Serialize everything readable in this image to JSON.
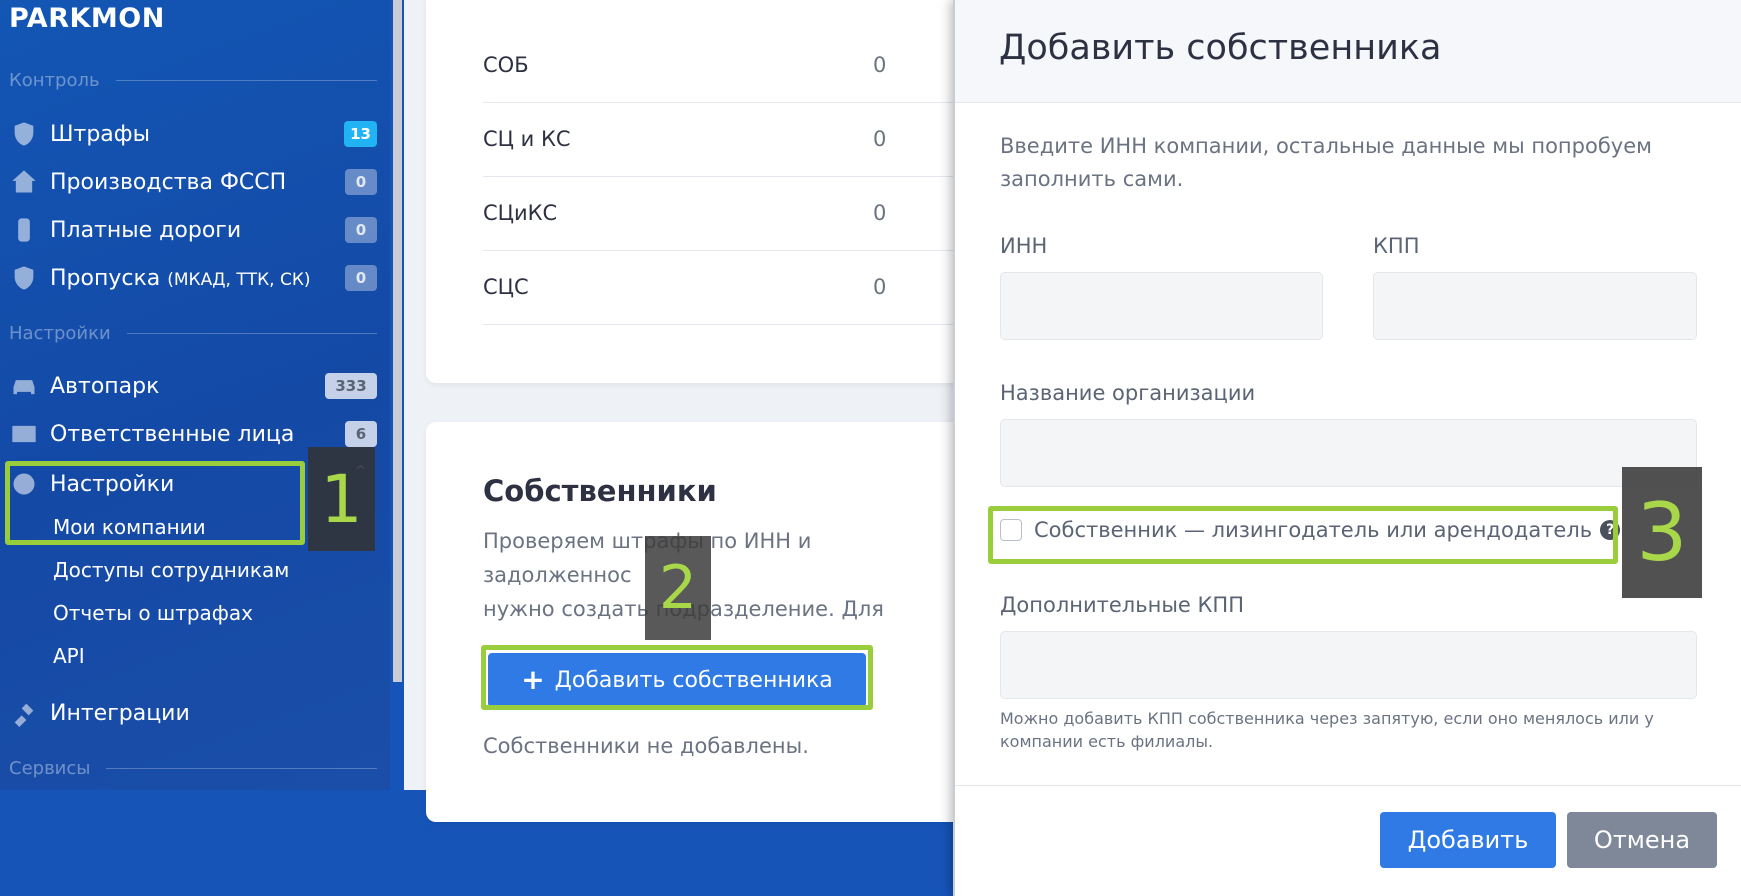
{
  "app": {
    "logo": "PARKMON"
  },
  "sidebar": {
    "sections": [
      {
        "label": "Контроль"
      },
      {
        "label": "Настройки"
      },
      {
        "label": "Сервисы"
      }
    ],
    "items": [
      {
        "label": "Штрафы",
        "badge": "13",
        "icon": "shield-icon"
      },
      {
        "label": "Производства ФССП",
        "badge": "0",
        "icon": "bailiff-icon"
      },
      {
        "label": "Платные дороги",
        "badge": "0",
        "icon": "road-icon"
      },
      {
        "label": "Пропуска",
        "label_small": "(МКАД, ТТК, СК)",
        "badge": "0",
        "icon": "shield-check-icon"
      },
      {
        "label": "Автопарк",
        "badge": "333",
        "icon": "car-icon"
      },
      {
        "label": "Ответственные лица",
        "badge": "6",
        "icon": "id-card-icon"
      },
      {
        "label": "Настройки",
        "icon": "gear-icon",
        "expanded": true
      },
      {
        "label": "Интеграции",
        "icon": "plug-icon"
      }
    ],
    "settings_sub": [
      {
        "label": "Мои компании"
      },
      {
        "label": "Доступы сотрудникам"
      },
      {
        "label": "Отчеты о штрафах"
      },
      {
        "label": "API"
      }
    ]
  },
  "table": {
    "rows": [
      {
        "name": "СОБ",
        "value": "0"
      },
      {
        "name": "СЦ и КС",
        "value": "0"
      },
      {
        "name": "СЦиКС",
        "value": "0"
      },
      {
        "name": "СЦС",
        "value": "0"
      }
    ]
  },
  "owners": {
    "title": "Собственники",
    "description": "Проверяем штрафы по ИНН и задолженнос\nнужно создать подразделение. Для лизинго\nиз раздела Автопарк.",
    "add_button": "Добавить собственника",
    "add_icon": "plus-icon",
    "empty": "Собственники не добавлены."
  },
  "annotations": [
    "1",
    "2",
    "3"
  ],
  "modal": {
    "title": "Добавить собственника",
    "intro": "Введите ИНН компании, остальные данные мы попробуем заполнить сами.",
    "fields": {
      "inn": {
        "label": "ИНН",
        "value": ""
      },
      "kpp": {
        "label": "КПП",
        "value": ""
      },
      "org_name": {
        "label": "Название организации",
        "value": ""
      },
      "extra_kpp": {
        "label": "Дополнительные КПП",
        "value": ""
      }
    },
    "lessor_checkbox": {
      "label": "Собственник — лизингодатель или арендодатель",
      "checked": false,
      "help": "?"
    },
    "extra_kpp_hint": "Можно добавить КПП собственника через запятую, если оно менялось или у компании есть филиалы.",
    "submit": "Добавить",
    "cancel": "Отмена"
  },
  "colors": {
    "sidebar": "#1449a6",
    "primary_button": "#2f7ae5",
    "cancel_button": "#7f8898",
    "highlight": "#9acd3b",
    "badge_accent": "#22b3f4"
  }
}
